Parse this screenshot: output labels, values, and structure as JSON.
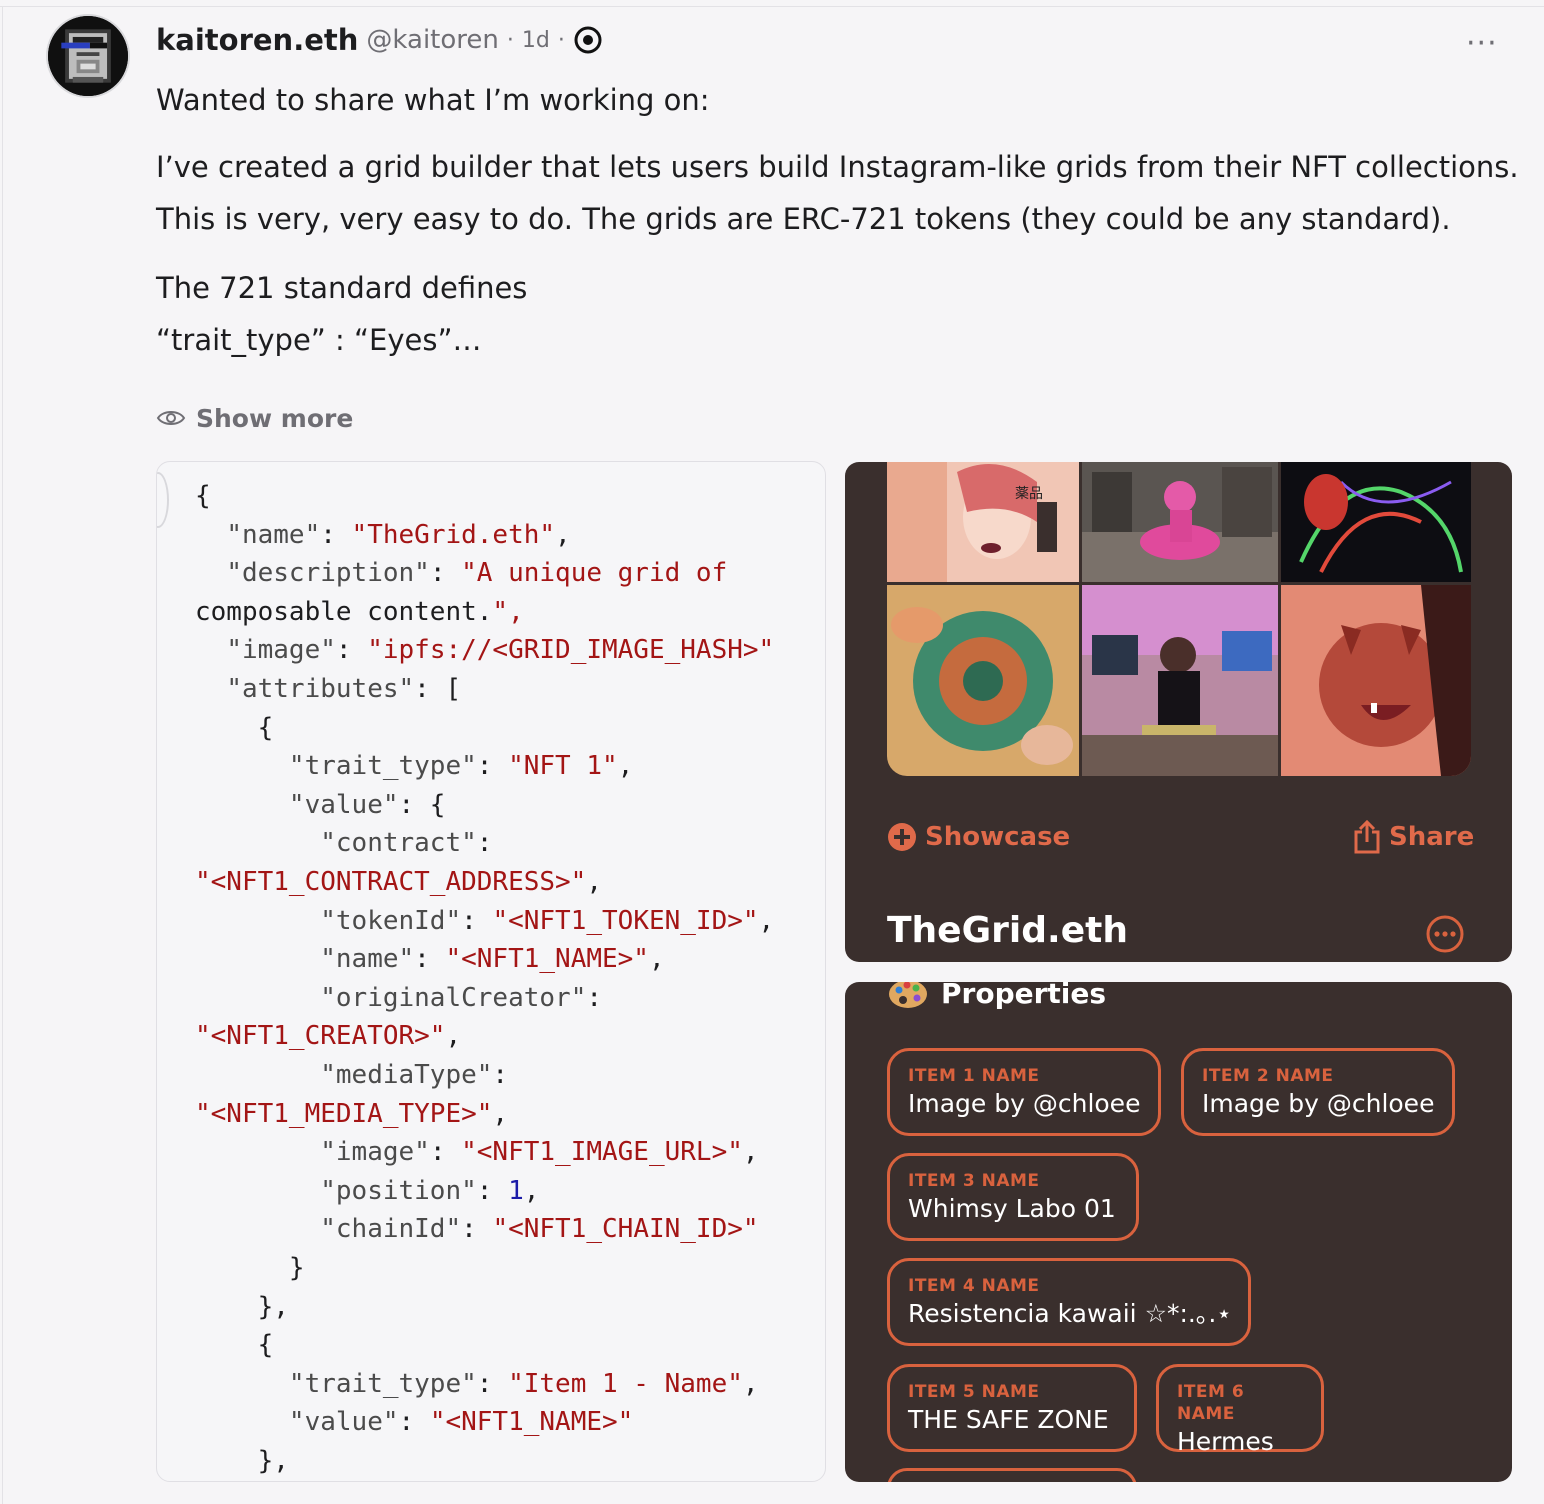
{
  "author": {
    "name": "kaitoren.eth",
    "handle": "@kaitoren",
    "separator": "·",
    "timestamp": "1d",
    "more": "···"
  },
  "post": {
    "line1": "Wanted to share what I’m working on:",
    "line2": "I’ve created a grid builder that lets users build Instagram-like grids from their NFT collections.",
    "line3": "This is very, very easy to do. The grids are ERC-721 tokens (they could be any standard).",
    "line4": "The 721 standard defines",
    "line5": "“trait_type” : “Eyes”…",
    "show_more": "Show more"
  },
  "code": {
    "lines": [
      "{",
      "  \"name\": \"TheGrid.eth\",",
      "  \"description\": \"A unique grid of",
      "composable content.\",",
      "  \"image\": \"ipfs://<GRID_IMAGE_HASH>\"",
      "  \"attributes\": [",
      "    {",
      "      \"trait_type\": \"NFT 1\",",
      "      \"value\": {",
      "        \"contract\":",
      "\"<NFT1_CONTRACT_ADDRESS>\",",
      "        \"tokenId\": \"<NFT1_TOKEN_ID>\",",
      "        \"name\": \"<NFT1_NAME>\",",
      "        \"originalCreator\":",
      "\"<NFT1_CREATOR>\",",
      "        \"mediaType\":",
      "\"<NFT1_MEDIA_TYPE>\",",
      "        \"image\": \"<NFT1_IMAGE_URL>\",",
      "        \"position\": 1,",
      "        \"chainId\": \"<NFT1_CHAIN_ID>\"",
      "      }",
      "    },",
      "    {",
      "      \"trait_type\": \"Item 1 - Name\",",
      "      \"value\": \"<NFT1_NAME>\"",
      "    },"
    ]
  },
  "grid_card": {
    "showcase_label": "Showcase",
    "share_label": "Share",
    "title": "TheGrid.eth",
    "tile_overlay_text": "薬品"
  },
  "properties": {
    "title": "Properties",
    "items": [
      {
        "label": "ITEM 1 NAME",
        "value": "Image by @chloee"
      },
      {
        "label": "ITEM 2 NAME",
        "value": "Image by @chloee"
      },
      {
        "label": "ITEM 3 NAME",
        "value": "Whimsy Labo 01"
      },
      {
        "label": "ITEM 4 NAME",
        "value": "Resistencia kawaii ☆*:.｡.⋆"
      },
      {
        "label": "ITEM 5 NAME",
        "value": "THE SAFE ZONE"
      },
      {
        "label": "ITEM 6 NAME",
        "value": "Hermes"
      }
    ]
  },
  "colors": {
    "accent": "#d9623e",
    "card_bg": "#3a2f2d",
    "code_string": "#a31515",
    "code_number": "#1c1ca8",
    "page_bg": "#f6f5f7"
  },
  "icons": [
    "channel-icon",
    "eye-icon",
    "plus-circle-icon",
    "share-icon",
    "more-circle-icon",
    "palette-icon"
  ]
}
